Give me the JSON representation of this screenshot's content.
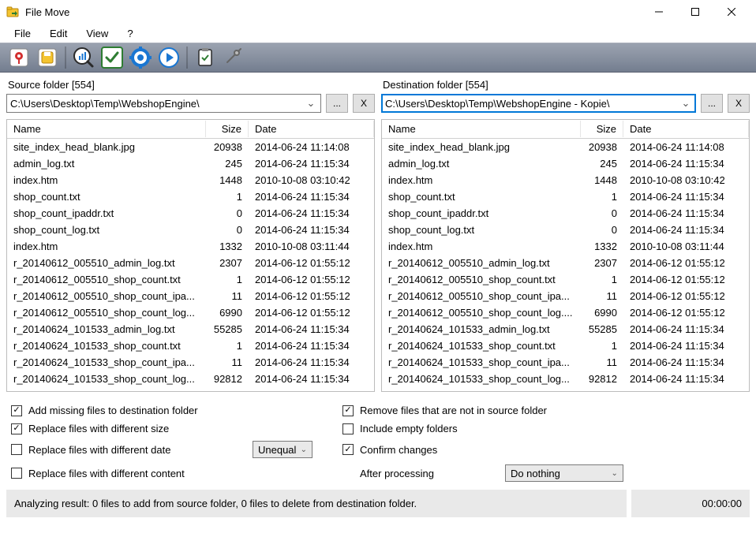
{
  "window": {
    "title": "File Move"
  },
  "menu": {
    "file": "File",
    "edit": "Edit",
    "view": "View",
    "help": "?"
  },
  "sourcePanel": {
    "label": "Source folder [554]",
    "path": "C:\\Users\\Desktop\\Temp\\WebshopEngine\\",
    "browse": "...",
    "clear": "X"
  },
  "destPanel": {
    "label": "Destination folder [554]",
    "path": "C:\\Users\\Desktop\\Temp\\WebshopEngine - Kopie\\",
    "browse": "...",
    "clear": "X"
  },
  "columns": {
    "name": "Name",
    "size": "Size",
    "date": "Date"
  },
  "files": [
    {
      "name": "site_index_head_blank.jpg",
      "size": "20938",
      "date": "2014-06-24 11:14:08"
    },
    {
      "name": "admin_log.txt",
      "size": "245",
      "date": "2014-06-24 11:15:34"
    },
    {
      "name": "index.htm",
      "size": "1448",
      "date": "2010-10-08 03:10:42"
    },
    {
      "name": "shop_count.txt",
      "size": "1",
      "date": "2014-06-24 11:15:34"
    },
    {
      "name": "shop_count_ipaddr.txt",
      "size": "0",
      "date": "2014-06-24 11:15:34"
    },
    {
      "name": "shop_count_log.txt",
      "size": "0",
      "date": "2014-06-24 11:15:34"
    },
    {
      "name": "index.htm",
      "size": "1332",
      "date": "2010-10-08 03:11:44"
    },
    {
      "name": "r_20140612_005510_admin_log.txt",
      "size": "2307",
      "date": "2014-06-12 01:55:12"
    },
    {
      "name": "r_20140612_005510_shop_count.txt",
      "size": "1",
      "date": "2014-06-12 01:55:12"
    },
    {
      "name": "r_20140612_005510_shop_count_ipa...",
      "size": "11",
      "date": "2014-06-12 01:55:12"
    },
    {
      "name": "r_20140612_005510_shop_count_log...",
      "size": "6990",
      "date": "2014-06-12 01:55:12"
    },
    {
      "name": "r_20140624_101533_admin_log.txt",
      "size": "55285",
      "date": "2014-06-24 11:15:34"
    },
    {
      "name": "r_20140624_101533_shop_count.txt",
      "size": "1",
      "date": "2014-06-24 11:15:34"
    },
    {
      "name": "r_20140624_101533_shop_count_ipa...",
      "size": "11",
      "date": "2014-06-24 11:15:34"
    },
    {
      "name": "r_20140624_101533_shop_count_log...",
      "size": "92812",
      "date": "2014-06-24 11:15:34"
    }
  ],
  "destFiles": [
    {
      "name": "site_index_head_blank.jpg",
      "size": "20938",
      "date": "2014-06-24 11:14:08"
    },
    {
      "name": "admin_log.txt",
      "size": "245",
      "date": "2014-06-24 11:15:34"
    },
    {
      "name": "index.htm",
      "size": "1448",
      "date": "2010-10-08 03:10:42"
    },
    {
      "name": "shop_count.txt",
      "size": "1",
      "date": "2014-06-24 11:15:34"
    },
    {
      "name": "shop_count_ipaddr.txt",
      "size": "0",
      "date": "2014-06-24 11:15:34"
    },
    {
      "name": "shop_count_log.txt",
      "size": "0",
      "date": "2014-06-24 11:15:34"
    },
    {
      "name": "index.htm",
      "size": "1332",
      "date": "2010-10-08 03:11:44"
    },
    {
      "name": "r_20140612_005510_admin_log.txt",
      "size": "2307",
      "date": "2014-06-12 01:55:12"
    },
    {
      "name": "r_20140612_005510_shop_count.txt",
      "size": "1",
      "date": "2014-06-12 01:55:12"
    },
    {
      "name": "r_20140612_005510_shop_count_ipa...",
      "size": "11",
      "date": "2014-06-12 01:55:12"
    },
    {
      "name": "r_20140612_005510_shop_count_log....",
      "size": "6990",
      "date": "2014-06-12 01:55:12"
    },
    {
      "name": "r_20140624_101533_admin_log.txt",
      "size": "55285",
      "date": "2014-06-24 11:15:34"
    },
    {
      "name": "r_20140624_101533_shop_count.txt",
      "size": "1",
      "date": "2014-06-24 11:15:34"
    },
    {
      "name": "r_20140624_101533_shop_count_ipa...",
      "size": "11",
      "date": "2014-06-24 11:15:34"
    },
    {
      "name": "r_20140624_101533_shop_count_log...",
      "size": "92812",
      "date": "2014-06-24 11:15:34"
    }
  ],
  "options": {
    "addMissing": "Add missing files to destination folder",
    "replaceSize": "Replace files with different size",
    "replaceDate": "Replace files with different date",
    "replaceContent": "Replace files with different content",
    "removeNotInSource": "Remove files that are not in source folder",
    "includeEmpty": "Include empty folders",
    "confirmChanges": "Confirm changes",
    "dateMode": "Unequal",
    "afterProcessingLabel": "After processing",
    "afterProcessing": "Do nothing"
  },
  "status": {
    "text": "Analyzing result: 0 files to add from source folder, 0 files to delete from destination folder.",
    "time": "00:00:00"
  }
}
